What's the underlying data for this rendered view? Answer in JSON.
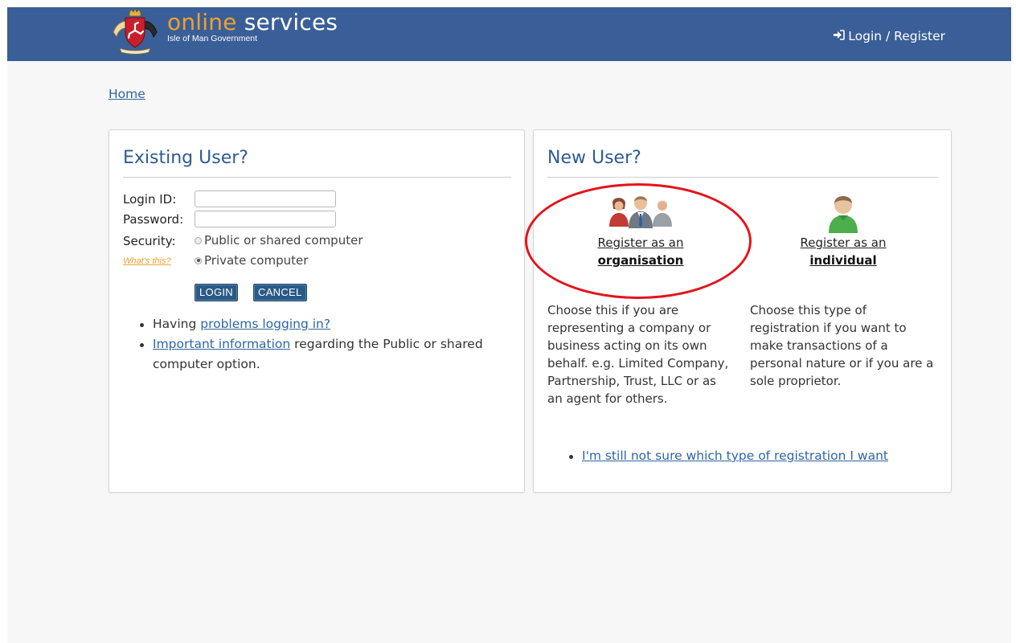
{
  "header": {
    "brand_online": "online",
    "brand_services": " services",
    "brand_subtitle": "Isle of Man Government",
    "login_register": "Login / Register",
    "login_icon": "sign-in-icon",
    "crest_icon": "crest-icon",
    "colors": {
      "bar": "#3a5f98",
      "accent": "#f0a030"
    }
  },
  "breadcrumb": {
    "home": "Home"
  },
  "existing": {
    "title": "Existing User?",
    "login_id_label": "Login ID:",
    "password_label": "Password:",
    "security_label": "Security:",
    "whats_this": "What's this?",
    "security_options": [
      {
        "label": "Public or shared computer",
        "checked": false
      },
      {
        "label": "Private computer",
        "checked": true
      }
    ],
    "login_button": "LOGIN",
    "cancel_button": "CANCEL",
    "help": {
      "problems_prefix": "Having ",
      "problems_link": "problems logging in?",
      "important_link": "Important information",
      "important_suffix_1": " regarding the Public or shared",
      "important_suffix_2": "computer option."
    }
  },
  "new_user": {
    "title": "New User?",
    "organisation": {
      "icon": "group-people-icon",
      "link_line1": "Register as an",
      "link_line2": "organisation",
      "description": [
        "Choose this if you are",
        "representing a company or",
        "business acting on its own",
        "behalf. e.g. Limited Company,",
        "Partnership, Trust, LLC or as",
        "an agent for others."
      ]
    },
    "individual": {
      "icon": "person-icon",
      "link_line1": "Register as an",
      "link_line2": "individual",
      "description": [
        "Choose this type of",
        "registration if you want to",
        "make transactions of a",
        "personal nature or if you are a",
        "sole proprietor."
      ]
    },
    "not_sure_link": "I'm still not sure which type of registration I want"
  }
}
